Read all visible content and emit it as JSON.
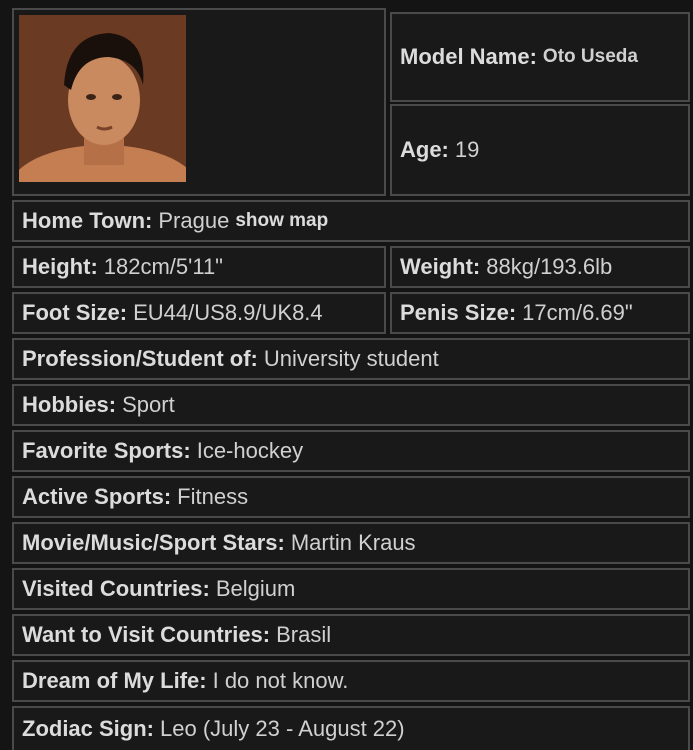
{
  "profile": {
    "photo_alt": "model photo",
    "model_name": {
      "label": "Model Name:",
      "value": "Oto Useda"
    },
    "age": {
      "label": "Age:",
      "value": "19"
    },
    "home_town": {
      "label": "Home Town:",
      "value": "Prague",
      "link": "show map"
    },
    "height": {
      "label": "Height:",
      "value": "182cm/5'11\""
    },
    "weight": {
      "label": "Weight:",
      "value": "88kg/193.6lb"
    },
    "foot_size": {
      "label": "Foot Size:",
      "value": "EU44/US8.9/UK8.4"
    },
    "penis_size": {
      "label": "Penis Size:",
      "value": "17cm/6.69\""
    },
    "profession": {
      "label": "Profession/Student of:",
      "value": "University student"
    },
    "hobbies": {
      "label": "Hobbies:",
      "value": "Sport"
    },
    "favorite_sports": {
      "label": "Favorite Sports:",
      "value": "Ice-hockey"
    },
    "active_sports": {
      "label": "Active Sports:",
      "value": "Fitness"
    },
    "stars": {
      "label": "Movie/Music/Sport Stars:",
      "value": "Martin Kraus"
    },
    "visited": {
      "label": "Visited Countries:",
      "value": "Belgium"
    },
    "want_visit": {
      "label": "Want to Visit Countries:",
      "value": "Brasil"
    },
    "dream": {
      "label": "Dream of My Life:",
      "value": "I do not know."
    },
    "zodiac": {
      "label": "Zodiac Sign:",
      "value": "Leo (July 23 - August 22)"
    }
  }
}
